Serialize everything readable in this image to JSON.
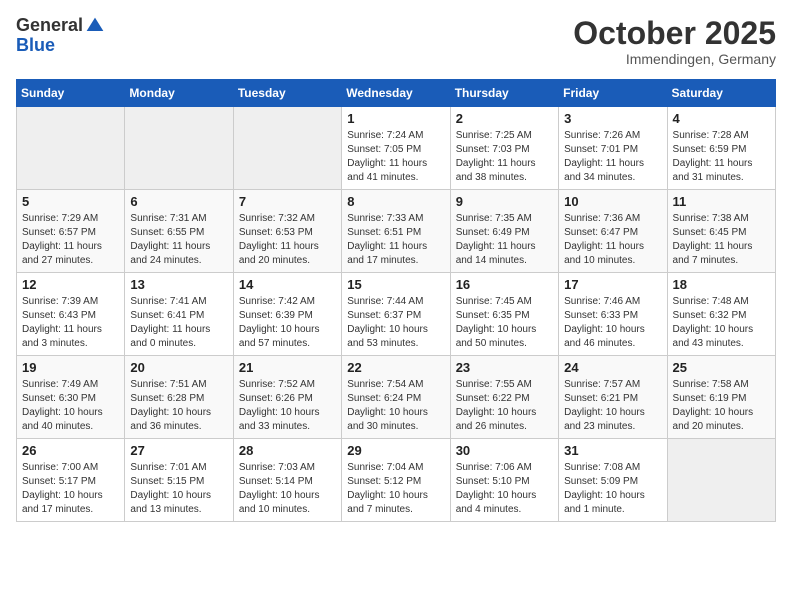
{
  "logo": {
    "general": "General",
    "blue": "Blue"
  },
  "header": {
    "month": "October 2025",
    "location": "Immendingen, Germany"
  },
  "weekdays": [
    "Sunday",
    "Monday",
    "Tuesday",
    "Wednesday",
    "Thursday",
    "Friday",
    "Saturday"
  ],
  "weeks": [
    [
      {
        "day": "",
        "info": ""
      },
      {
        "day": "",
        "info": ""
      },
      {
        "day": "",
        "info": ""
      },
      {
        "day": "1",
        "info": "Sunrise: 7:24 AM\nSunset: 7:05 PM\nDaylight: 11 hours\nand 41 minutes."
      },
      {
        "day": "2",
        "info": "Sunrise: 7:25 AM\nSunset: 7:03 PM\nDaylight: 11 hours\nand 38 minutes."
      },
      {
        "day": "3",
        "info": "Sunrise: 7:26 AM\nSunset: 7:01 PM\nDaylight: 11 hours\nand 34 minutes."
      },
      {
        "day": "4",
        "info": "Sunrise: 7:28 AM\nSunset: 6:59 PM\nDaylight: 11 hours\nand 31 minutes."
      }
    ],
    [
      {
        "day": "5",
        "info": "Sunrise: 7:29 AM\nSunset: 6:57 PM\nDaylight: 11 hours\nand 27 minutes."
      },
      {
        "day": "6",
        "info": "Sunrise: 7:31 AM\nSunset: 6:55 PM\nDaylight: 11 hours\nand 24 minutes."
      },
      {
        "day": "7",
        "info": "Sunrise: 7:32 AM\nSunset: 6:53 PM\nDaylight: 11 hours\nand 20 minutes."
      },
      {
        "day": "8",
        "info": "Sunrise: 7:33 AM\nSunset: 6:51 PM\nDaylight: 11 hours\nand 17 minutes."
      },
      {
        "day": "9",
        "info": "Sunrise: 7:35 AM\nSunset: 6:49 PM\nDaylight: 11 hours\nand 14 minutes."
      },
      {
        "day": "10",
        "info": "Sunrise: 7:36 AM\nSunset: 6:47 PM\nDaylight: 11 hours\nand 10 minutes."
      },
      {
        "day": "11",
        "info": "Sunrise: 7:38 AM\nSunset: 6:45 PM\nDaylight: 11 hours\nand 7 minutes."
      }
    ],
    [
      {
        "day": "12",
        "info": "Sunrise: 7:39 AM\nSunset: 6:43 PM\nDaylight: 11 hours\nand 3 minutes."
      },
      {
        "day": "13",
        "info": "Sunrise: 7:41 AM\nSunset: 6:41 PM\nDaylight: 11 hours\nand 0 minutes."
      },
      {
        "day": "14",
        "info": "Sunrise: 7:42 AM\nSunset: 6:39 PM\nDaylight: 10 hours\nand 57 minutes."
      },
      {
        "day": "15",
        "info": "Sunrise: 7:44 AM\nSunset: 6:37 PM\nDaylight: 10 hours\nand 53 minutes."
      },
      {
        "day": "16",
        "info": "Sunrise: 7:45 AM\nSunset: 6:35 PM\nDaylight: 10 hours\nand 50 minutes."
      },
      {
        "day": "17",
        "info": "Sunrise: 7:46 AM\nSunset: 6:33 PM\nDaylight: 10 hours\nand 46 minutes."
      },
      {
        "day": "18",
        "info": "Sunrise: 7:48 AM\nSunset: 6:32 PM\nDaylight: 10 hours\nand 43 minutes."
      }
    ],
    [
      {
        "day": "19",
        "info": "Sunrise: 7:49 AM\nSunset: 6:30 PM\nDaylight: 10 hours\nand 40 minutes."
      },
      {
        "day": "20",
        "info": "Sunrise: 7:51 AM\nSunset: 6:28 PM\nDaylight: 10 hours\nand 36 minutes."
      },
      {
        "day": "21",
        "info": "Sunrise: 7:52 AM\nSunset: 6:26 PM\nDaylight: 10 hours\nand 33 minutes."
      },
      {
        "day": "22",
        "info": "Sunrise: 7:54 AM\nSunset: 6:24 PM\nDaylight: 10 hours\nand 30 minutes."
      },
      {
        "day": "23",
        "info": "Sunrise: 7:55 AM\nSunset: 6:22 PM\nDaylight: 10 hours\nand 26 minutes."
      },
      {
        "day": "24",
        "info": "Sunrise: 7:57 AM\nSunset: 6:21 PM\nDaylight: 10 hours\nand 23 minutes."
      },
      {
        "day": "25",
        "info": "Sunrise: 7:58 AM\nSunset: 6:19 PM\nDaylight: 10 hours\nand 20 minutes."
      }
    ],
    [
      {
        "day": "26",
        "info": "Sunrise: 7:00 AM\nSunset: 5:17 PM\nDaylight: 10 hours\nand 17 minutes."
      },
      {
        "day": "27",
        "info": "Sunrise: 7:01 AM\nSunset: 5:15 PM\nDaylight: 10 hours\nand 13 minutes."
      },
      {
        "day": "28",
        "info": "Sunrise: 7:03 AM\nSunset: 5:14 PM\nDaylight: 10 hours\nand 10 minutes."
      },
      {
        "day": "29",
        "info": "Sunrise: 7:04 AM\nSunset: 5:12 PM\nDaylight: 10 hours\nand 7 minutes."
      },
      {
        "day": "30",
        "info": "Sunrise: 7:06 AM\nSunset: 5:10 PM\nDaylight: 10 hours\nand 4 minutes."
      },
      {
        "day": "31",
        "info": "Sunrise: 7:08 AM\nSunset: 5:09 PM\nDaylight: 10 hours\nand 1 minute."
      },
      {
        "day": "",
        "info": ""
      }
    ]
  ]
}
